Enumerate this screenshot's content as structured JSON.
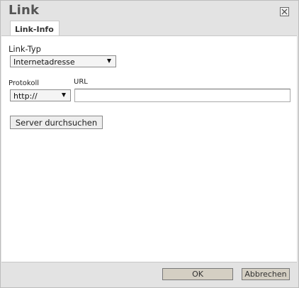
{
  "dialog": {
    "title": "Link",
    "close_icon": "close-x-icon"
  },
  "tabs": [
    {
      "label": "Link-Info",
      "active": true
    }
  ],
  "form": {
    "link_type_label": "Link-Typ",
    "link_type_value": "Internetadresse",
    "protocol_label": "Protokoll",
    "protocol_value": "http://",
    "url_label": "URL",
    "url_value": "",
    "browse_server_label": "Server durchsuchen"
  },
  "footer": {
    "ok_label": "OK",
    "cancel_label": "Abbrechen"
  }
}
